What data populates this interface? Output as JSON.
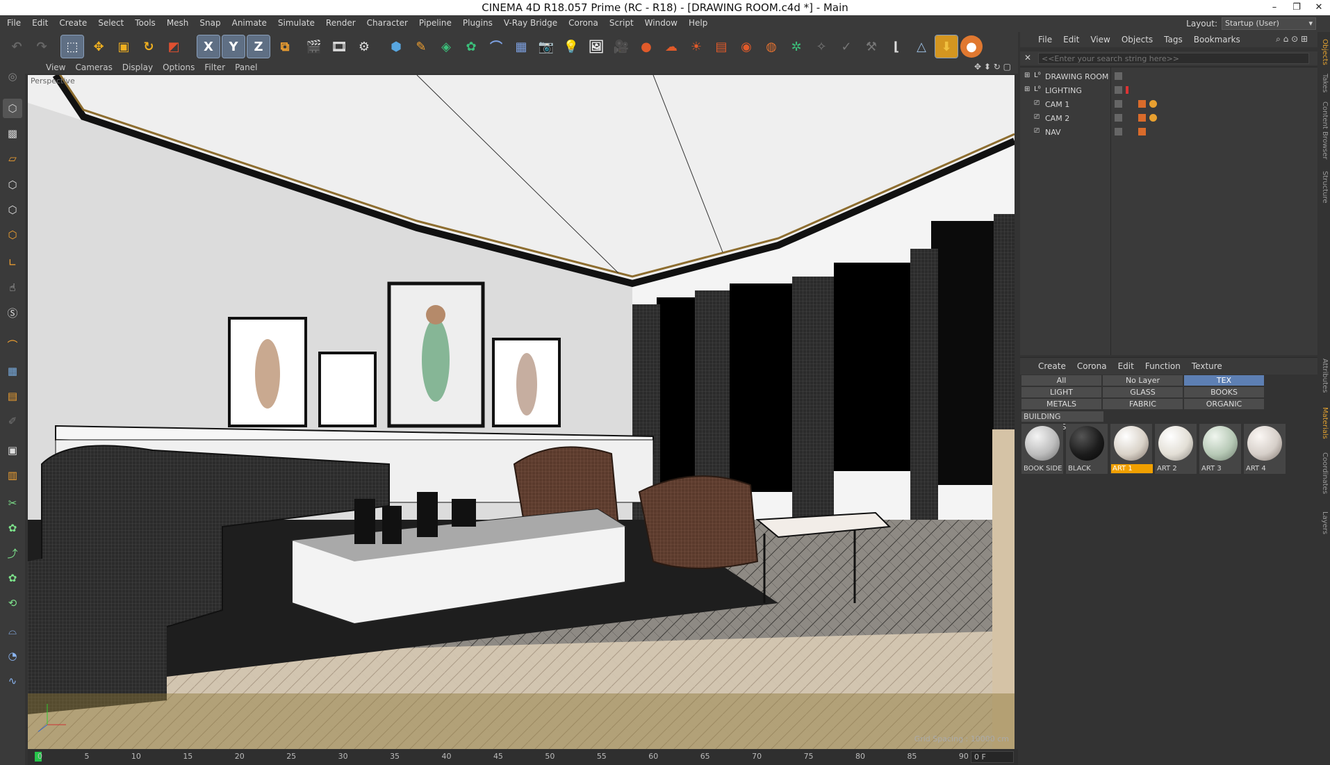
{
  "window": {
    "title": "CINEMA 4D R18.057 Prime (RC - R18) - [DRAWING ROOM.c4d *] - Main",
    "minimize": "–",
    "restore": "❐",
    "close": "✕"
  },
  "menubar": {
    "items": [
      "File",
      "Edit",
      "Create",
      "Select",
      "Tools",
      "Mesh",
      "Snap",
      "Animate",
      "Simulate",
      "Render",
      "Character",
      "Pipeline",
      "Plugins",
      "V-Ray Bridge",
      "Corona",
      "Script",
      "Window",
      "Help"
    ],
    "layout_label": "Layout:",
    "layout_value": "Startup (User)"
  },
  "toolbar": {
    "axis_x": "X",
    "axis_y": "Y",
    "axis_z": "Z"
  },
  "viewport": {
    "menu": [
      "View",
      "Cameras",
      "Display",
      "Options",
      "Filter",
      "Panel"
    ],
    "camera_label": "Perspective",
    "grid_spacing": "Grid Spacing : 10000 cm"
  },
  "timeline": {
    "ticks": [
      "0",
      "5",
      "10",
      "15",
      "20",
      "25",
      "30",
      "35",
      "40",
      "45",
      "50",
      "55",
      "60",
      "65",
      "70",
      "75",
      "80",
      "85",
      "90"
    ],
    "frame": "0 F"
  },
  "object_manager": {
    "menu": [
      "File",
      "Edit",
      "View",
      "Objects",
      "Tags",
      "Bookmarks"
    ],
    "search_placeholder": "<<Enter your search string here>>",
    "objects": [
      {
        "name": "DRAWING ROOM",
        "type": "layer"
      },
      {
        "name": "LIGHTING",
        "type": "layer"
      },
      {
        "name": "CAM 1",
        "type": "camera"
      },
      {
        "name": "CAM 2",
        "type": "camera"
      },
      {
        "name": "NAV",
        "type": "camera"
      }
    ]
  },
  "material_manager": {
    "menu": [
      "Create",
      "Corona",
      "Edit",
      "Function",
      "Texture"
    ],
    "filters": [
      "All",
      "No Layer",
      "TEX",
      "LIGHT",
      "GLASS",
      "BOOKS",
      "METALS",
      "FABRIC",
      "ORGANIC"
    ],
    "active_filter": "TEX",
    "section": "BUILDING MATERIALS",
    "materials": [
      {
        "name": "BOOK SIDE",
        "color": "#bdbdbd"
      },
      {
        "name": "BLACK",
        "color": "#1c1c1c"
      },
      {
        "name": "ART 1",
        "color": "#d9d2c8",
        "selected": true
      },
      {
        "name": "ART 2",
        "color": "#e3dfd6"
      },
      {
        "name": "ART 3",
        "color": "#b7c9b6"
      },
      {
        "name": "ART 4",
        "color": "#d6cfc9"
      }
    ]
  },
  "side_tabs": [
    "Objects",
    "Takes",
    "Content Browser",
    "Structure",
    "Attributes",
    "Materials",
    "Coordinates",
    "Layers"
  ],
  "colors": {
    "accent": "#5d7fb3",
    "selected_material": "#f0a000",
    "panel": "#3a3a3a"
  }
}
